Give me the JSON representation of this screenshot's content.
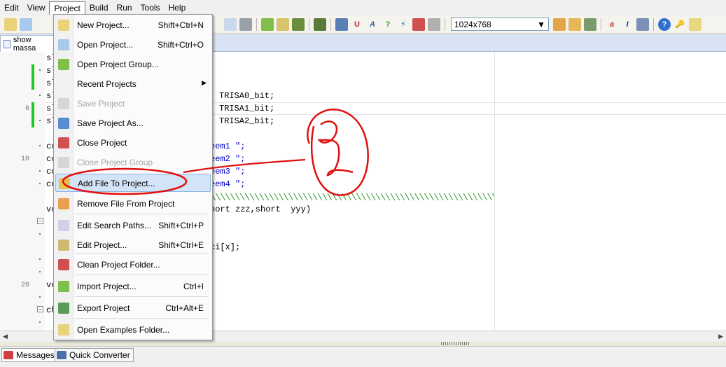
{
  "menubar": {
    "items": [
      "Edit",
      "View",
      "Project",
      "Build",
      "Run",
      "Tools",
      "Help"
    ],
    "active": "Project"
  },
  "toolbar": {
    "resolution_value": "1024x768"
  },
  "document_tab": {
    "label": "show massa"
  },
  "editor": {
    "line_numbers": [
      "6",
      "10",
      "20"
    ],
    "code_lines": [
      {
        "prefix": "sl",
        "suffix": ""
      },
      {
        "prefix": "sl",
        "suffix": ""
      },
      {
        "prefix": "sl",
        "suffix": ""
      },
      {
        "prefix": "sl",
        "suffix": "TRISA0_bit;"
      },
      {
        "prefix": "sl",
        "suffix": "TRISA1_bit;"
      },
      {
        "prefix": "sl",
        "suffix": "TRISA2_bit;"
      },
      {
        "prefix": "",
        "suffix": ""
      },
      {
        "prefix": "co",
        "suffix": "eem1 \";"
      },
      {
        "prefix": "co",
        "suffix": "eem2 \";"
      },
      {
        "prefix": "co",
        "suffix": "eem3 \";"
      },
      {
        "prefix": "co",
        "suffix": "eem4 \";"
      },
      {
        "prefix": "",
        "suffix": ""
      },
      {
        "prefix": "vo",
        "suffix": "hort zzz,short  yyy)"
      },
      {
        "prefix": "",
        "suffix": ""
      },
      {
        "prefix": "",
        "suffix": ""
      },
      {
        "prefix": "",
        "suffix": "ci[x];"
      },
      {
        "prefix": "",
        "suffix": ""
      },
      {
        "prefix": "",
        "suffix": ""
      },
      {
        "prefix": "vo",
        "suffix": ""
      },
      {
        "prefix": "",
        "suffix": ""
      },
      {
        "prefix": "ch",
        "suffix": ""
      }
    ]
  },
  "project_menu": {
    "items": [
      {
        "label": "New Project...",
        "shortcut": "Shift+Ctrl+N",
        "enabled": true
      },
      {
        "label": "Open Project...",
        "shortcut": "Shift+Ctrl+O",
        "enabled": true
      },
      {
        "label": "Open Project Group...",
        "shortcut": "",
        "enabled": true
      },
      {
        "label": "Recent Projects",
        "shortcut": "",
        "enabled": true,
        "submenu": true
      },
      {
        "label": "Save Project",
        "shortcut": "",
        "enabled": false
      },
      {
        "label": "Save Project As...",
        "shortcut": "",
        "enabled": true
      },
      {
        "label": "Close Project",
        "shortcut": "",
        "enabled": true
      },
      {
        "label": "Close Project Group",
        "shortcut": "",
        "enabled": false
      },
      {
        "label": "Add File To Project...",
        "shortcut": "",
        "enabled": true,
        "highlighted": true
      },
      {
        "label": "Remove File From Project",
        "shortcut": "",
        "enabled": true
      },
      {
        "label": "Edit Search Paths...",
        "shortcut": "Shift+Ctrl+P",
        "enabled": true
      },
      {
        "label": "Edit Project...",
        "shortcut": "Shift+Ctrl+E",
        "enabled": true
      },
      {
        "label": "Clean Project Folder...",
        "shortcut": "",
        "enabled": true
      },
      {
        "label": "Import Project...",
        "shortcut": "Ctrl+I",
        "enabled": true
      },
      {
        "label": "Export  Project",
        "shortcut": "Ctrl+Alt+E",
        "enabled": true
      },
      {
        "label": "Open Examples Folder...",
        "shortcut": "",
        "enabled": true
      }
    ]
  },
  "bottom_tabs": [
    "Messages",
    "Quick Converter"
  ],
  "colors": {
    "annotation": "#e01010",
    "highlight": "#d4e4f8",
    "green_marker": "#1ec81e"
  }
}
